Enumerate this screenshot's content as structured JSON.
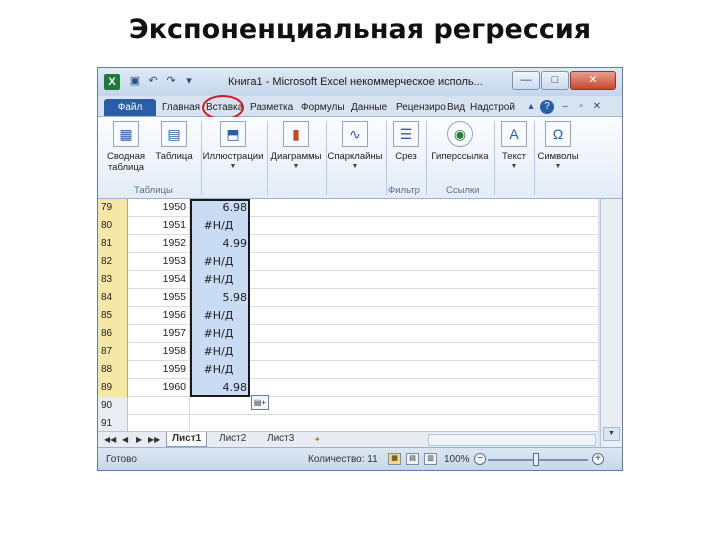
{
  "slide": {
    "title": "Экспоненциальная регрессия"
  },
  "window": {
    "title": "Книга1 - Microsoft Excel некоммерческое исполь...",
    "minimize": "—",
    "maximize": "□",
    "close": "✕"
  },
  "quick_access": {
    "save_icon": "save-icon",
    "undo_icon": "undo-icon",
    "redo_icon": "redo-icon"
  },
  "tabs": [
    "Файл",
    "Главная",
    "Вставка",
    "Разметка",
    "Формулы",
    "Данные",
    "Рецензиро",
    "Вид",
    "Надстрой"
  ],
  "ribbon": {
    "buttons": [
      {
        "label1": "Сводная",
        "label2": "таблица",
        "icon": "pivot-table-icon"
      },
      {
        "label1": "Таблица",
        "label2": "",
        "icon": "table-icon"
      },
      {
        "label1": "Иллюстрации",
        "label2": "",
        "icon": "illustrations-icon"
      },
      {
        "label1": "Диаграммы",
        "label2": "",
        "icon": "charts-icon"
      },
      {
        "label1": "Спарклайны",
        "label2": "",
        "icon": "sparklines-icon"
      },
      {
        "label1": "Срез",
        "label2": "",
        "icon": "slicer-icon"
      },
      {
        "label1": "Гиперссылка",
        "label2": "",
        "icon": "hyperlink-icon"
      },
      {
        "label1": "Текст",
        "label2": "",
        "icon": "text-icon"
      },
      {
        "label1": "Символы",
        "label2": "",
        "icon": "symbols-icon"
      }
    ],
    "groups": [
      "Таблицы",
      "Фильтр",
      "Ссылки"
    ]
  },
  "grid": {
    "rows": [
      {
        "num": "79",
        "year": "1950",
        "value": "6.98"
      },
      {
        "num": "80",
        "year": "1951",
        "value": "#Н/Д"
      },
      {
        "num": "81",
        "year": "1952",
        "value": "4.99"
      },
      {
        "num": "82",
        "year": "1953",
        "value": "#Н/Д"
      },
      {
        "num": "83",
        "year": "1954",
        "value": "#Н/Д"
      },
      {
        "num": "84",
        "year": "1955",
        "value": "5.98"
      },
      {
        "num": "85",
        "year": "1956",
        "value": "#Н/Д"
      },
      {
        "num": "86",
        "year": "1957",
        "value": "#Н/Д"
      },
      {
        "num": "87",
        "year": "1958",
        "value": "#Н/Д"
      },
      {
        "num": "88",
        "year": "1959",
        "value": "#Н/Д"
      },
      {
        "num": "89",
        "year": "1960",
        "value": "4.98"
      },
      {
        "num": "90",
        "year": "",
        "value": ""
      },
      {
        "num": "91",
        "year": "",
        "value": ""
      }
    ]
  },
  "sheets": [
    "Лист1",
    "Лист2",
    "Лист3"
  ],
  "status": {
    "ready": "Готово",
    "count": "Количество: 11",
    "zoom": "100%"
  }
}
